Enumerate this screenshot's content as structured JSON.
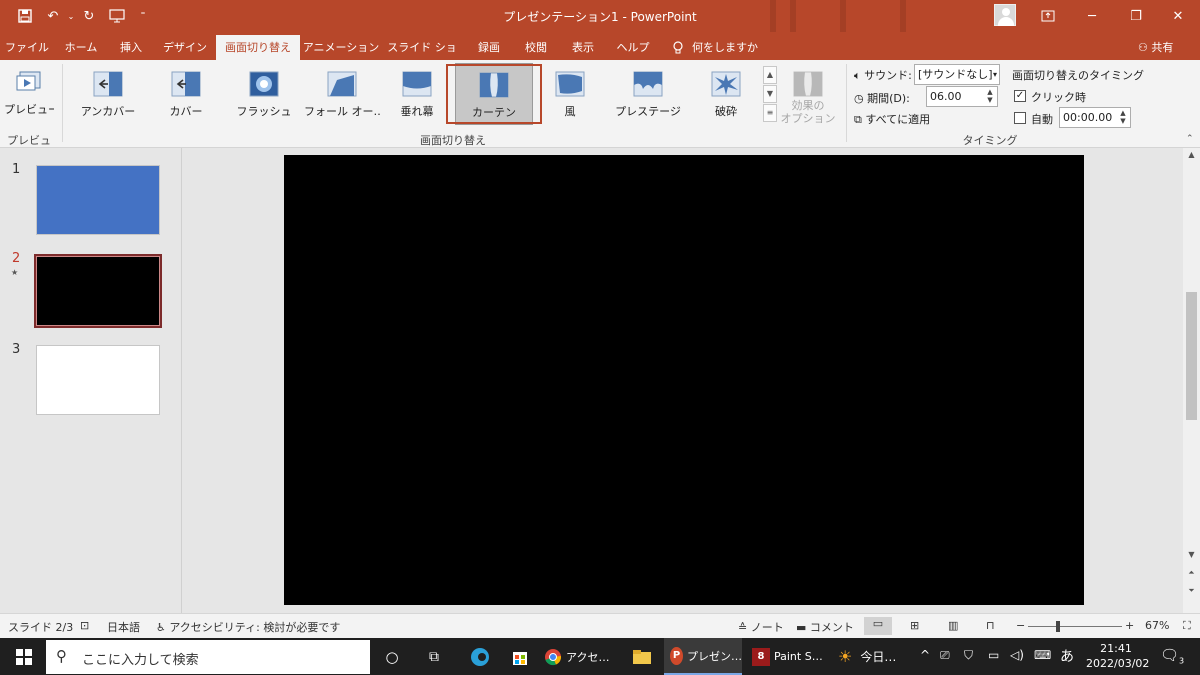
{
  "window": {
    "title": "プレゼンテーション1  -  PowerPoint",
    "colors": {
      "accent": "#b7472a",
      "selected_gallery": "#c7c7c7",
      "slide1": "#4472c4",
      "slide2": "#000000",
      "slide3": "#ffffff"
    }
  },
  "qat": {
    "save_icon": "save-icon",
    "undo_icon": "undo-icon",
    "redo_icon": "redo-icon",
    "present_icon": "present-from-beginning-icon"
  },
  "tabs": [
    "ファイル",
    "ホーム",
    "挿入",
    "デザイン",
    "画面切り替え",
    "アニメーション",
    "スライド ショー",
    "録画",
    "校閲",
    "表示",
    "ヘルプ",
    "何をしますか"
  ],
  "active_tab": "画面切り替え",
  "share_label": "共有",
  "ribbon": {
    "preview": {
      "button": "プレビュー",
      "group": "プレビュー"
    },
    "transitions": {
      "group": "画面切り替え",
      "items": [
        "アンカバー",
        "カバー",
        "フラッシュ",
        "フォール オー…",
        "垂れ幕",
        "カーテン",
        "風",
        "プレステージ",
        "破砕"
      ],
      "selected": "カーテン",
      "effect_options": "効果の\nオプション"
    },
    "timing": {
      "group": "タイミング",
      "sound_label": "サウンド:",
      "sound_value": "[サウンドなし]",
      "duration_label": "期間(D):",
      "duration_value": "06.00",
      "apply_all": "すべてに適用",
      "advance_title": "画面切り替えのタイミング",
      "on_click": "クリック時",
      "on_click_checked": true,
      "auto": "自動",
      "auto_checked": false,
      "auto_value": "00:00.00"
    }
  },
  "slides": [
    {
      "number": "1",
      "color": "#4472c4"
    },
    {
      "number": "2",
      "color": "#000000",
      "selected": true,
      "mark": "★"
    },
    {
      "number": "3",
      "color": "#ffffff"
    }
  ],
  "status": {
    "slide": "スライド 2/3",
    "language": "日本語",
    "accessibility": "アクセシビリティ: 検討が必要です",
    "notes": "ノート",
    "comments": "コメント",
    "zoom": "67%"
  },
  "taskbar": {
    "search_placeholder": "ここに入力して検索",
    "apps": [
      "アクセ…",
      "プレゼン…",
      "Paint S…",
      "今日…"
    ],
    "ime": "あ",
    "time": "21:41",
    "date": "2022/03/02",
    "notifications": "3"
  }
}
